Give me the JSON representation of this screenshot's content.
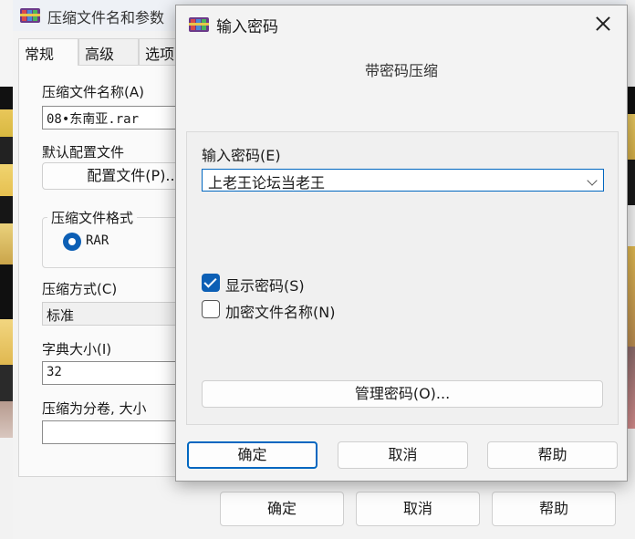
{
  "back": {
    "title": "压缩文件名和参数",
    "tabs": [
      "常规",
      "高级",
      "选项"
    ],
    "archive_name_label": "压缩文件名称(A)",
    "archive_name_value": "08•东南亚.rar",
    "default_profile_label": "默认配置文件",
    "profiles_button": "配置文件(P)...",
    "format_group_label": "压缩文件格式",
    "format_rar": "RAR",
    "method_label": "压缩方式(C)",
    "method_value": "标准",
    "dict_label": "字典大小(I)",
    "dict_value": "32",
    "split_label": "压缩为分卷, 大小",
    "ok": "确定",
    "cancel": "取消",
    "help": "帮助"
  },
  "dialog": {
    "title": "输入密码",
    "subheading": "带密码压缩",
    "password_label": "输入密码(E)",
    "password_value": "上老王论坛当老王",
    "show_password_label": "显示密码(S)",
    "show_password_checked": true,
    "encrypt_names_label": "加密文件名称(N)",
    "encrypt_names_checked": false,
    "manage_button": "管理密码(O)...",
    "ok": "确定",
    "cancel": "取消",
    "help": "帮助"
  }
}
